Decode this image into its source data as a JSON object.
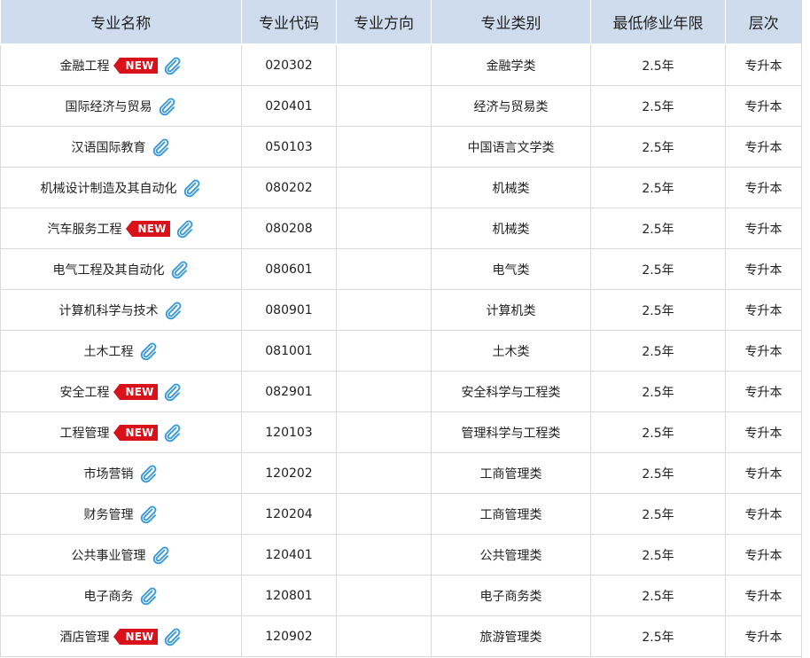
{
  "columns": [
    "专业名称",
    "专业代码",
    "专业方向",
    "专业类别",
    "最低修业年限",
    "层次"
  ],
  "badge_text": "NEW",
  "icons": {
    "attachment": "paperclip-icon"
  },
  "colors": {
    "header_bg": "#cfdcee",
    "badge_red": "#d8111b",
    "clip_blue": "#3a9ad9",
    "grid": "#d9d9d9"
  },
  "rows": [
    {
      "name": "金融工程",
      "is_new": true,
      "code": "020302",
      "direction": "",
      "category": "金融学类",
      "years": "2.5年",
      "level": "专升本"
    },
    {
      "name": "国际经济与贸易",
      "is_new": false,
      "code": "020401",
      "direction": "",
      "category": "经济与贸易类",
      "years": "2.5年",
      "level": "专升本"
    },
    {
      "name": "汉语国际教育",
      "is_new": false,
      "code": "050103",
      "direction": "",
      "category": "中国语言文学类",
      "years": "2.5年",
      "level": "专升本"
    },
    {
      "name": "机械设计制造及其自动化",
      "is_new": false,
      "code": "080202",
      "direction": "",
      "category": "机械类",
      "years": "2.5年",
      "level": "专升本"
    },
    {
      "name": "汽车服务工程",
      "is_new": true,
      "code": "080208",
      "direction": "",
      "category": "机械类",
      "years": "2.5年",
      "level": "专升本"
    },
    {
      "name": "电气工程及其自动化",
      "is_new": false,
      "code": "080601",
      "direction": "",
      "category": "电气类",
      "years": "2.5年",
      "level": "专升本"
    },
    {
      "name": "计算机科学与技术",
      "is_new": false,
      "code": "080901",
      "direction": "",
      "category": "计算机类",
      "years": "2.5年",
      "level": "专升本"
    },
    {
      "name": "土木工程",
      "is_new": false,
      "code": "081001",
      "direction": "",
      "category": "土木类",
      "years": "2.5年",
      "level": "专升本"
    },
    {
      "name": "安全工程",
      "is_new": true,
      "code": "082901",
      "direction": "",
      "category": "安全科学与工程类",
      "years": "2.5年",
      "level": "专升本"
    },
    {
      "name": "工程管理",
      "is_new": true,
      "code": "120103",
      "direction": "",
      "category": "管理科学与工程类",
      "years": "2.5年",
      "level": "专升本"
    },
    {
      "name": "市场营销",
      "is_new": false,
      "code": "120202",
      "direction": "",
      "category": "工商管理类",
      "years": "2.5年",
      "level": "专升本"
    },
    {
      "name": "财务管理",
      "is_new": false,
      "code": "120204",
      "direction": "",
      "category": "工商管理类",
      "years": "2.5年",
      "level": "专升本"
    },
    {
      "name": "公共事业管理",
      "is_new": false,
      "code": "120401",
      "direction": "",
      "category": "公共管理类",
      "years": "2.5年",
      "level": "专升本"
    },
    {
      "name": "电子商务",
      "is_new": false,
      "code": "120801",
      "direction": "",
      "category": "电子商务类",
      "years": "2.5年",
      "level": "专升本"
    },
    {
      "name": "酒店管理",
      "is_new": true,
      "code": "120902",
      "direction": "",
      "category": "旅游管理类",
      "years": "2.5年",
      "level": "专升本"
    }
  ]
}
